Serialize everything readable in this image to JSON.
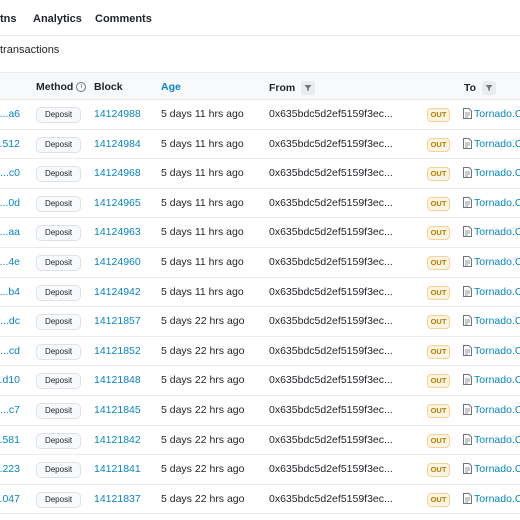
{
  "tabs": [
    {
      "label": "tns"
    },
    {
      "label": "Analytics"
    },
    {
      "label": "Comments"
    }
  ],
  "summary": "transactions",
  "table": {
    "headers": {
      "method": "Method",
      "block": "Block",
      "age": "Age",
      "from": "From",
      "to": "To"
    },
    "rows": [
      {
        "hash": "a6...",
        "method": "Deposit",
        "block": "14124988",
        "age": "5 days 11 hrs ago",
        "from": "0x635bdc5d2ef5159f3ec...",
        "direction": "OUT",
        "to": "Tornado.Ca"
      },
      {
        "hash": "512...",
        "method": "Deposit",
        "block": "14124984",
        "age": "5 days 11 hrs ago",
        "from": "0x635bdc5d2ef5159f3ec...",
        "direction": "OUT",
        "to": "Tornado.Ca"
      },
      {
        "hash": "c0...",
        "method": "Deposit",
        "block": "14124968",
        "age": "5 days 11 hrs ago",
        "from": "0x635bdc5d2ef5159f3ec...",
        "direction": "OUT",
        "to": "Tornado.Ca"
      },
      {
        "hash": "0d...",
        "method": "Deposit",
        "block": "14124965",
        "age": "5 days 11 hrs ago",
        "from": "0x635bdc5d2ef5159f3ec...",
        "direction": "OUT",
        "to": "Tornado.Ca"
      },
      {
        "hash": "aa...",
        "method": "Deposit",
        "block": "14124963",
        "age": "5 days 11 hrs ago",
        "from": "0x635bdc5d2ef5159f3ec...",
        "direction": "OUT",
        "to": "Tornado.Ca"
      },
      {
        "hash": "4e...",
        "method": "Deposit",
        "block": "14124960",
        "age": "5 days 11 hrs ago",
        "from": "0x635bdc5d2ef5159f3ec...",
        "direction": "OUT",
        "to": "Tornado.Ca"
      },
      {
        "hash": "b4...",
        "method": "Deposit",
        "block": "14124942",
        "age": "5 days 11 hrs ago",
        "from": "0x635bdc5d2ef5159f3ec...",
        "direction": "OUT",
        "to": "Tornado.Ca"
      },
      {
        "hash": "dc...",
        "method": "Deposit",
        "block": "14121857",
        "age": "5 days 22 hrs ago",
        "from": "0x635bdc5d2ef5159f3ec...",
        "direction": "OUT",
        "to": "Tornado.Ca"
      },
      {
        "hash": "cd...",
        "method": "Deposit",
        "block": "14121852",
        "age": "5 days 22 hrs ago",
        "from": "0x635bdc5d2ef5159f3ec...",
        "direction": "OUT",
        "to": "Tornado.Ca"
      },
      {
        "hash": "d10...",
        "method": "Deposit",
        "block": "14121848",
        "age": "5 days 22 hrs ago",
        "from": "0x635bdc5d2ef5159f3ec...",
        "direction": "OUT",
        "to": "Tornado.Ca"
      },
      {
        "hash": "c7...",
        "method": "Deposit",
        "block": "14121845",
        "age": "5 days 22 hrs ago",
        "from": "0x635bdc5d2ef5159f3ec...",
        "direction": "OUT",
        "to": "Tornado.Ca"
      },
      {
        "hash": "581...",
        "method": "Deposit",
        "block": "14121842",
        "age": "5 days 22 hrs ago",
        "from": "0x635bdc5d2ef5159f3ec...",
        "direction": "OUT",
        "to": "Tornado.Ca"
      },
      {
        "hash": "223...",
        "method": "Deposit",
        "block": "14121841",
        "age": "5 days 22 hrs ago",
        "from": "0x635bdc5d2ef5159f3ec...",
        "direction": "OUT",
        "to": "Tornado.Ca"
      },
      {
        "hash": "047...",
        "method": "Deposit",
        "block": "14121837",
        "age": "5 days 22 hrs ago",
        "from": "0x635bdc5d2ef5159f3ec...",
        "direction": "OUT",
        "to": "Tornado.Ca"
      }
    ]
  },
  "icons": {
    "method_info": "info-circle-icon",
    "from_filter": "filter-icon",
    "to_filter": "filter-icon",
    "contract": "document-icon"
  },
  "colors": {
    "link": "#0784c3",
    "out_badge_bg": "#fdf3e1",
    "out_badge_text": "#b47d00"
  }
}
